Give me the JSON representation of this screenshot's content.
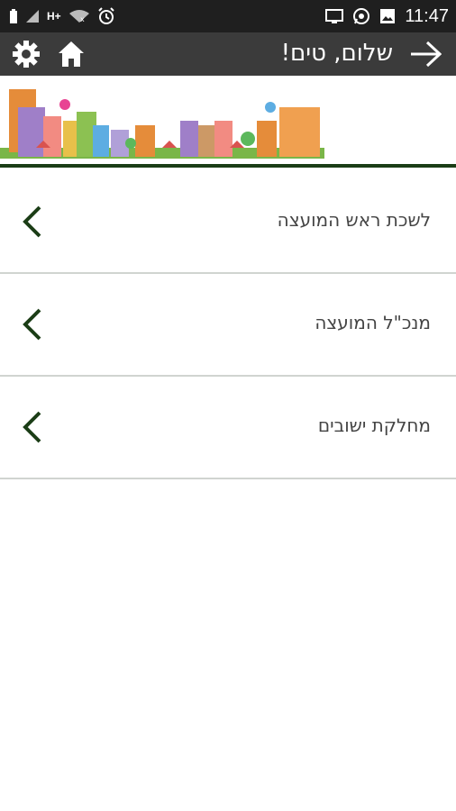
{
  "status_bar": {
    "time": "11:47",
    "network": "H+"
  },
  "header": {
    "title": "שלום, טים!"
  },
  "menu": {
    "items": [
      {
        "label": "לשכת ראש המועצה"
      },
      {
        "label": "מנכ\"ל המועצה"
      },
      {
        "label": "מחלקת ישובים"
      }
    ]
  },
  "colors": {
    "status_bar": "#1f1f1f",
    "app_bar": "#3b3b3b",
    "accent_green": "#1b3d16",
    "divider": "#d0d4d0"
  }
}
